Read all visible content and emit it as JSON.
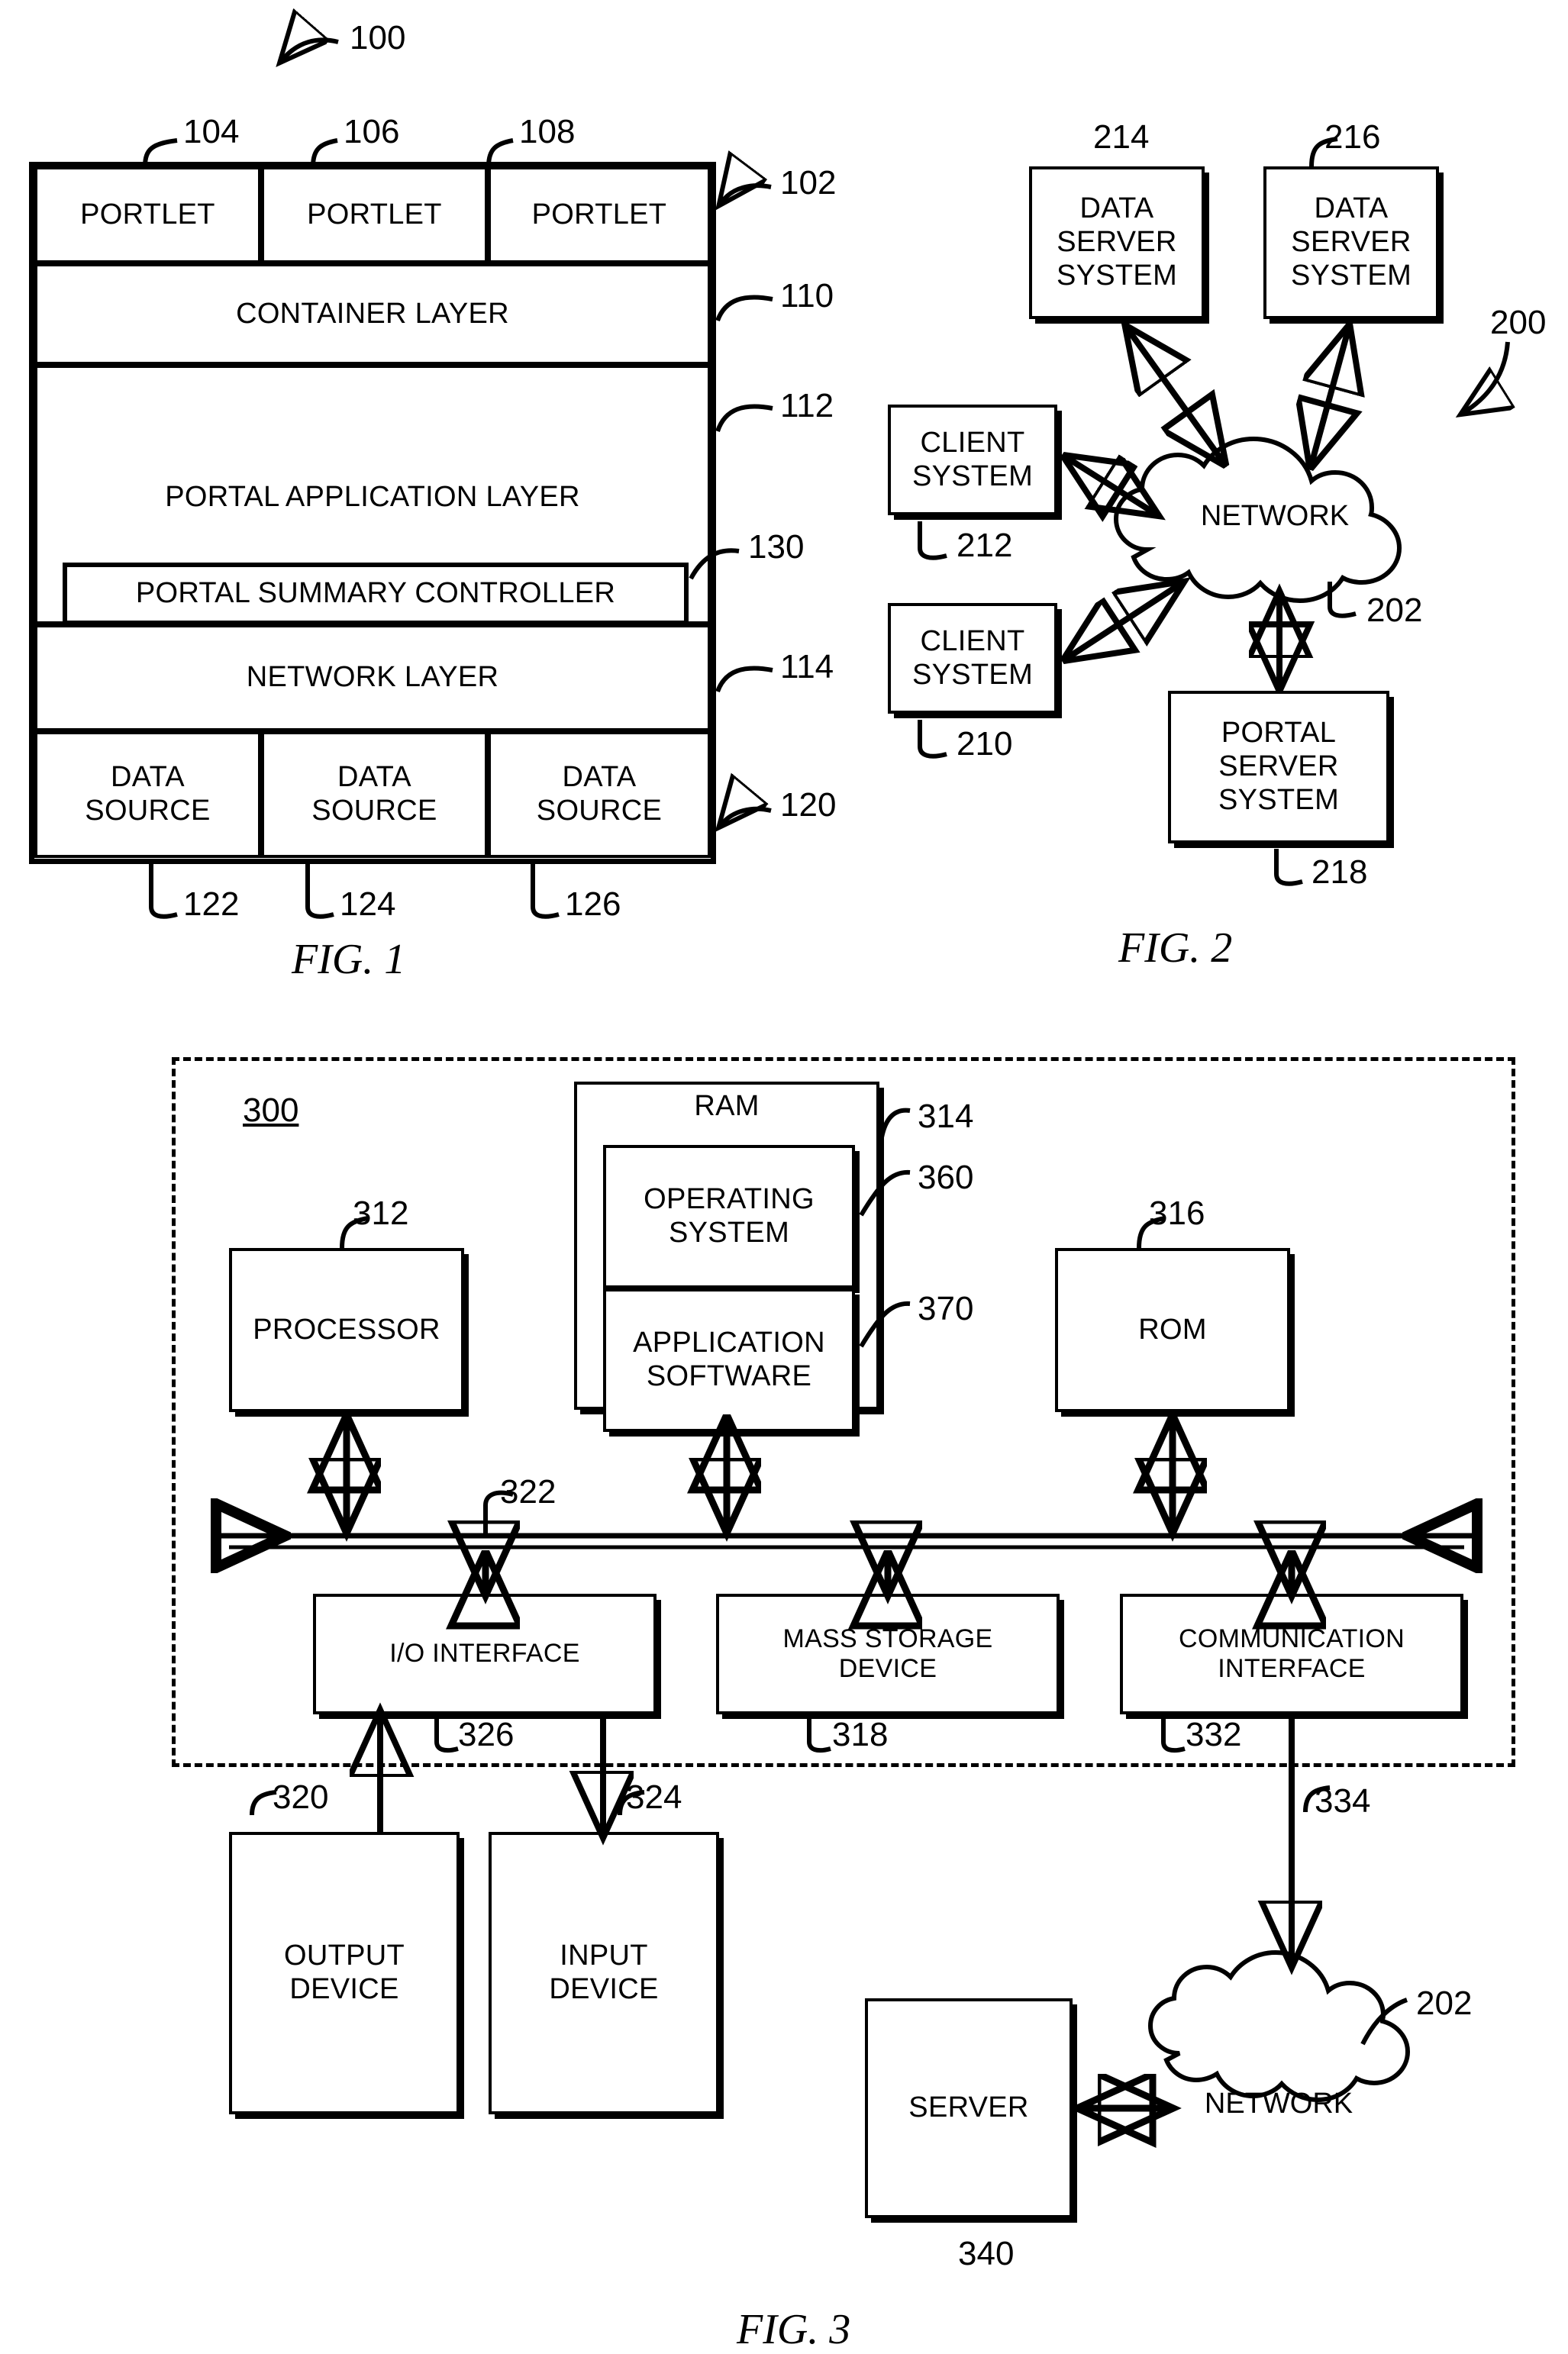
{
  "figures": [
    {
      "id": "fig1",
      "caption": "FIG. 1",
      "overall_ref": "100",
      "system_ref": "102",
      "portlets": [
        {
          "label": "PORTLET",
          "ref": "104"
        },
        {
          "label": "PORTLET",
          "ref": "106"
        },
        {
          "label": "PORTLET",
          "ref": "108"
        }
      ],
      "layers": [
        {
          "label": "CONTAINER LAYER",
          "ref": "110"
        },
        {
          "label": "PORTAL APPLICATION LAYER",
          "ref": "112"
        },
        {
          "label": "NETWORK LAYER",
          "ref": "114"
        }
      ],
      "controller": {
        "label": "PORTAL SUMMARY CONTROLLER",
        "ref": "130"
      },
      "data_sources_ref": "120",
      "data_sources": [
        {
          "label": "DATA\nSOURCE",
          "ref": "122"
        },
        {
          "label": "DATA\nSOURCE",
          "ref": "124"
        },
        {
          "label": "DATA\nSOURCE",
          "ref": "126"
        }
      ]
    },
    {
      "id": "fig2",
      "caption": "FIG. 2",
      "overall_ref": "200",
      "nodes": [
        {
          "label": "DATA\nSERVER\nSYSTEM",
          "ref": "214"
        },
        {
          "label": "DATA\nSERVER\nSYSTEM",
          "ref": "216"
        },
        {
          "label": "CLIENT\nSYSTEM",
          "ref": "212"
        },
        {
          "label": "CLIENT\nSYSTEM",
          "ref": "210"
        },
        {
          "label": "PORTAL\nSERVER\nSYSTEM",
          "ref": "218"
        }
      ],
      "network": {
        "label": "NETWORK",
        "ref": "202"
      }
    },
    {
      "id": "fig3",
      "caption": "FIG. 3",
      "enclosure_ref": "300",
      "nodes": [
        {
          "label": "PROCESSOR",
          "ref": "312"
        },
        {
          "label": "RAM",
          "ref": "314"
        },
        {
          "label": "OPERATING\nSYSTEM",
          "ref": "360"
        },
        {
          "label": "APPLICATION\nSOFTWARE",
          "ref": "370"
        },
        {
          "label": "ROM",
          "ref": "316"
        },
        {
          "label": "I/O INTERFACE",
          "ref": "326"
        },
        {
          "label": "MASS STORAGE\nDEVICE",
          "ref": "318"
        },
        {
          "label": "COMMUNICATION\nINTERFACE",
          "ref": "332"
        },
        {
          "label": "OUTPUT\nDEVICE",
          "ref": "320"
        },
        {
          "label": "INPUT\nDEVICE",
          "ref": "324"
        },
        {
          "label": "SERVER",
          "ref": "340"
        }
      ],
      "bus_ref": "322",
      "comm_link_ref": "334",
      "network": {
        "label": "NETWORK",
        "ref": "202"
      }
    }
  ],
  "colors": {
    "ink": "#000000",
    "paper": "#ffffff"
  }
}
